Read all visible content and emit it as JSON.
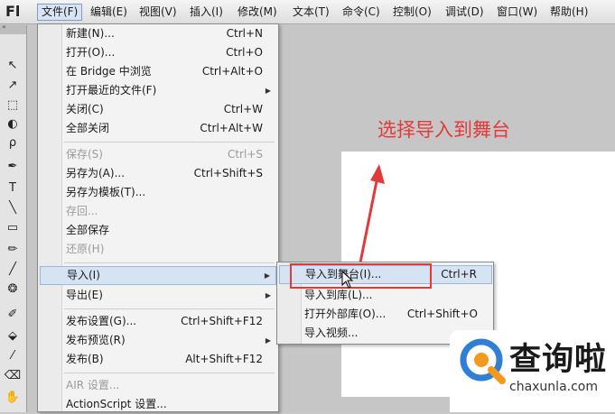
{
  "app": {
    "logo": "Fl"
  },
  "menubar": {
    "items": [
      "文件(F)",
      "编辑(E)",
      "视图(V)",
      "插入(I)",
      "修改(M)",
      "文本(T)",
      "命令(C)",
      "控制(O)",
      "调试(D)",
      "窗口(W)",
      "帮助(H)"
    ]
  },
  "toolbar": {
    "header": "«",
    "tools": [
      "↖",
      "↗",
      "⬚",
      "◐",
      "ρ",
      "✒",
      "T",
      "╲",
      "▭",
      "✏",
      "╱",
      "❂",
      "✐",
      "⬙",
      "⁄",
      "⌫",
      "✋"
    ]
  },
  "file_menu": {
    "items": [
      {
        "label": "新建(N)...",
        "shortcut": "Ctrl+N"
      },
      {
        "label": "打开(O)...",
        "shortcut": "Ctrl+O"
      },
      {
        "label": "在 Bridge 中浏览",
        "shortcut": "Ctrl+Alt+O"
      },
      {
        "label": "打开最近的文件(F)",
        "shortcut": ""
      },
      {
        "label": "关闭(C)",
        "shortcut": "Ctrl+W"
      },
      {
        "label": "全部关闭",
        "shortcut": "Ctrl+Alt+W"
      },
      {
        "label": "保存(S)",
        "shortcut": "Ctrl+S"
      },
      {
        "label": "另存为(A)...",
        "shortcut": "Ctrl+Shift+S"
      },
      {
        "label": "另存为模板(T)...",
        "shortcut": ""
      },
      {
        "label": "存回...",
        "shortcut": ""
      },
      {
        "label": "全部保存",
        "shortcut": ""
      },
      {
        "label": "还原(H)",
        "shortcut": ""
      },
      {
        "label": "导入(I)",
        "shortcut": ""
      },
      {
        "label": "导出(E)",
        "shortcut": ""
      },
      {
        "label": "发布设置(G)...",
        "shortcut": "Ctrl+Shift+F12"
      },
      {
        "label": "发布预览(R)",
        "shortcut": ""
      },
      {
        "label": "发布(B)",
        "shortcut": "Alt+Shift+F12"
      },
      {
        "label": "AIR 设置...",
        "shortcut": ""
      },
      {
        "label": "ActionScript 设置...",
        "shortcut": ""
      }
    ]
  },
  "import_submenu": {
    "items": [
      {
        "label": "导入到舞台(I)...",
        "shortcut": "Ctrl+R"
      },
      {
        "label": "导入到库(L)...",
        "shortcut": ""
      },
      {
        "label": "打开外部库(O)...",
        "shortcut": "Ctrl+Shift+O"
      },
      {
        "label": "导入视频...",
        "shortcut": ""
      }
    ]
  },
  "annotation": {
    "text": "选择导入到舞台"
  },
  "watermark": {
    "name": "查询啦",
    "url": "chaxunla.com"
  },
  "colors": {
    "annotation": "#e03a3a",
    "highlight": "#d6e3f3",
    "watermark_blue": "#2f7fd6",
    "watermark_orange": "#f39a1e"
  }
}
